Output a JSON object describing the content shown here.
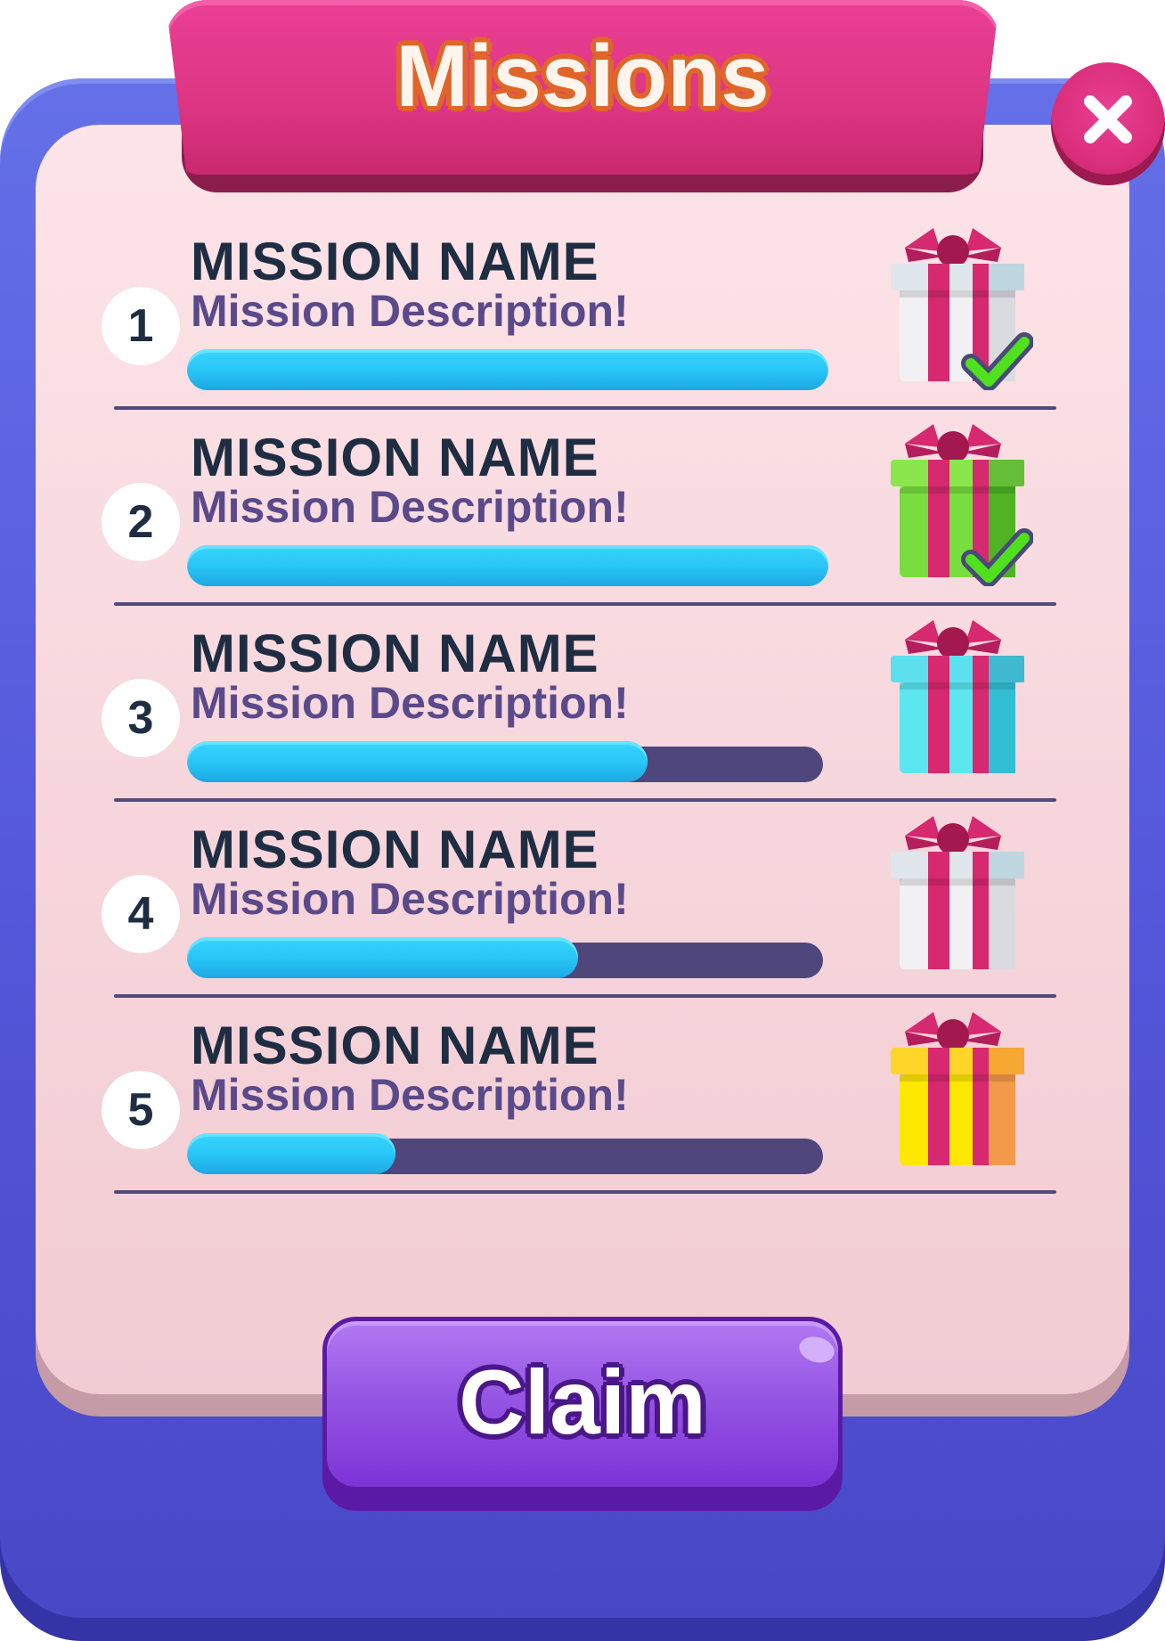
{
  "title": "Missions",
  "close_icon": "close-icon",
  "claim_label": "Claim",
  "missions": [
    {
      "number": "1",
      "name": "MISSION NAME",
      "description": "Mission Description!",
      "progress": 1.0,
      "gift_color": "white",
      "completed": true
    },
    {
      "number": "2",
      "name": "MISSION NAME",
      "description": "Mission Description!",
      "progress": 1.0,
      "gift_color": "green",
      "completed": true
    },
    {
      "number": "3",
      "name": "MISSION NAME",
      "description": "Mission Description!",
      "progress": 0.73,
      "gift_color": "cyan",
      "completed": false
    },
    {
      "number": "4",
      "name": "MISSION NAME",
      "description": "Mission Description!",
      "progress": 0.62,
      "gift_color": "white",
      "completed": false
    },
    {
      "number": "5",
      "name": "MISSION NAME",
      "description": "Mission Description!",
      "progress": 0.33,
      "gift_color": "yellow",
      "completed": false
    }
  ],
  "colors": {
    "frame": "#5558db",
    "banner": "#dd3584",
    "progress_fill": "#27c4f5",
    "progress_track": "#4f477c",
    "claim_button": "#9656e4",
    "checkmark": "#4fe11e"
  }
}
